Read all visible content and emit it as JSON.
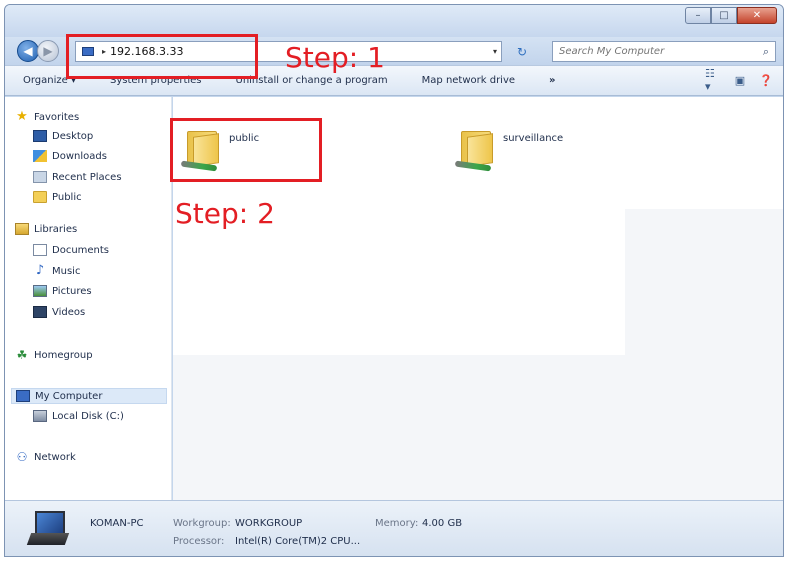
{
  "window": {
    "controls": {
      "minimize": "–",
      "maximize": "□",
      "close": "✕"
    }
  },
  "address_bar": {
    "crumb_icon": "computer-icon",
    "crumb_arrow": "▸",
    "path": "192.168.3.33",
    "dropdown": "▾",
    "refresh": "↻"
  },
  "search": {
    "placeholder": "Search My Computer",
    "icon": "⌕"
  },
  "toolbar": {
    "organize": "Organize ▾",
    "system_properties": "System properties",
    "uninstall": "Uninstall or change a program",
    "map_network_drive": "Map network drive",
    "more": "»",
    "view_icon": "☷ ▾",
    "preview_icon": "▣",
    "help_icon": "❓"
  },
  "sidebar": {
    "favorites": "Favorites",
    "desktop": "Desktop",
    "downloads": "Downloads",
    "recent_places": "Recent Places",
    "public": "Public",
    "libraries": "Libraries",
    "documents": "Documents",
    "music": "Music",
    "pictures": "Pictures",
    "videos": "Videos",
    "homegroup": "Homegroup",
    "my_computer": "My Computer",
    "local_disk": "Local Disk (C:)",
    "network": "Network"
  },
  "items": [
    {
      "label": "public"
    },
    {
      "label": "surveillance"
    }
  ],
  "annotations": {
    "step1": "Step: 1",
    "step2": "Step: 2"
  },
  "details": {
    "computer_name": "KOMAN-PC",
    "workgroup_label": "Workgroup:",
    "workgroup_value": "WORKGROUP",
    "memory_label": "Memory:",
    "memory_value": "4.00 GB",
    "processor_label": "Processor:",
    "processor_value": "Intel(R) Core(TM)2 CPU..."
  },
  "colors": {
    "annotation_red": "#e31e24",
    "toolbar_bg": "#dbe6f4"
  }
}
